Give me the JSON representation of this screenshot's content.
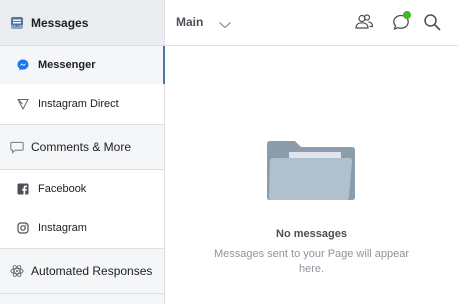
{
  "sidebar": {
    "messages": {
      "label": "Messages",
      "icon": "inbox-icon",
      "accent": "#4a76a8"
    },
    "messenger": {
      "label": "Messenger",
      "icon": "messenger-icon"
    },
    "instagram_direct": {
      "label": "Instagram Direct",
      "icon": "send-triangle-icon"
    },
    "comments": {
      "label": "Comments & More",
      "icon": "comment-bubble-icon"
    },
    "facebook": {
      "label": "Facebook",
      "icon": "facebook-icon"
    },
    "instagram": {
      "label": "Instagram",
      "icon": "instagram-icon"
    },
    "automated": {
      "label": "Automated Responses",
      "icon": "automation-icon"
    }
  },
  "header": {
    "title": "Main",
    "icons": [
      "people-icon",
      "chat-bubble-icon",
      "search-icon"
    ],
    "status_color": "#42b72a"
  },
  "empty_state": {
    "title": "No messages",
    "subtitle": "Messages sent to your Page will appear here.",
    "icon": "folder-icon"
  }
}
